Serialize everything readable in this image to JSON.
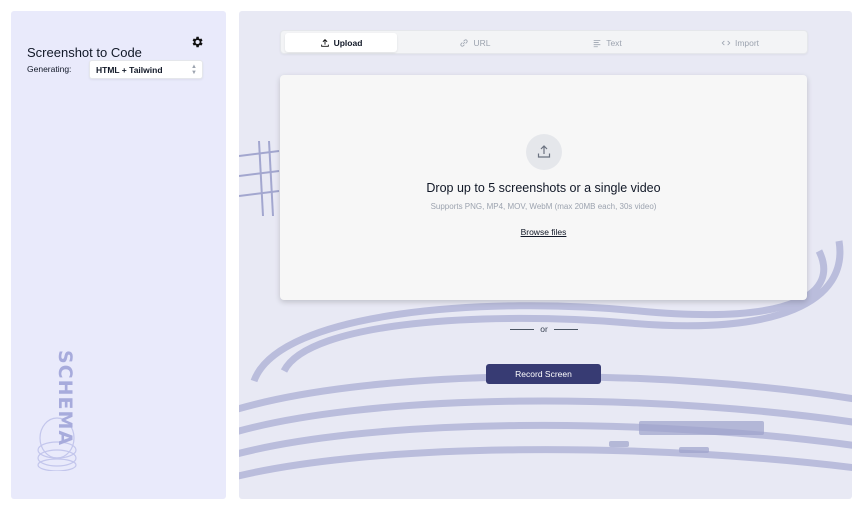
{
  "sidebar": {
    "title": "Screenshot to Code",
    "generating_label": "Generating:",
    "stack_value": "HTML + Tailwind",
    "watermark": "SCHEMA"
  },
  "tabs": [
    {
      "label": "Upload",
      "icon": "upload-icon",
      "active": true
    },
    {
      "label": "URL",
      "icon": "link-icon",
      "active": false
    },
    {
      "label": "Text",
      "icon": "text-icon",
      "active": false
    },
    {
      "label": "Import",
      "icon": "code-icon",
      "active": false
    }
  ],
  "dropzone": {
    "headline": "Drop up to 5 screenshots or a single video",
    "supported": "Supports PNG, MP4, MOV, WebM (max 20MB each, 30s video)",
    "browse_label": "Browse files"
  },
  "divider_text": "or",
  "record_button": "Record Screen",
  "colors": {
    "accent": "#373b73",
    "sidebar_bg": "#e9eafb",
    "main_bg": "#e8e9f4"
  }
}
